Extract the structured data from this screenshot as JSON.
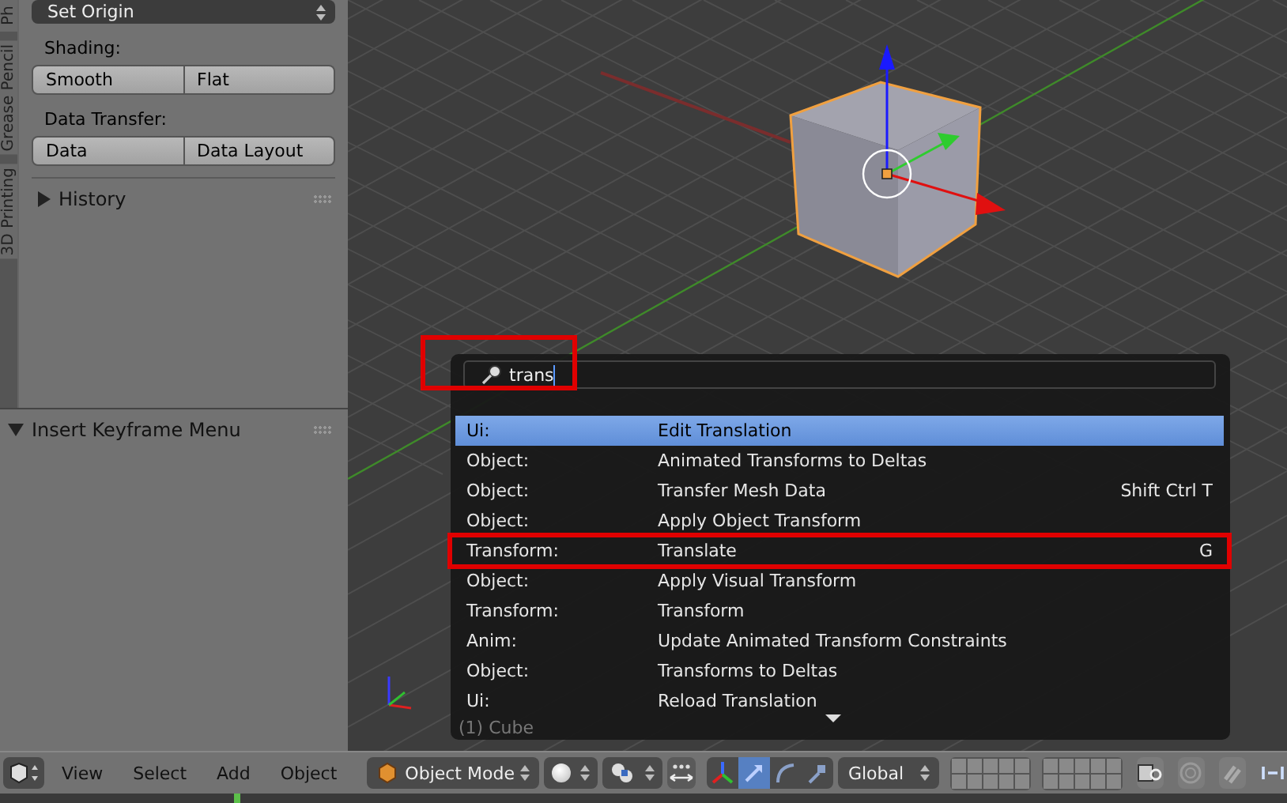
{
  "side_tabs": [
    "Ph",
    "Grease Pencil",
    "3D Printing"
  ],
  "tools_panel": {
    "origin_dropdown": "Set Origin",
    "groups": [
      {
        "label": "Shading:",
        "buttons": [
          "Smooth",
          "Flat"
        ]
      },
      {
        "label": "Data Transfer:",
        "buttons": [
          "Data",
          "Data Layout"
        ]
      }
    ],
    "history": {
      "label": "History",
      "expanded": false
    }
  },
  "keyframe_panel": {
    "label": "Insert Keyframe Menu",
    "expanded": true
  },
  "viewport": {
    "object_label": "(1) Cube"
  },
  "search_menu": {
    "query": "trans",
    "highlighted": true,
    "rows": [
      {
        "category": "Ui:",
        "name": "Edit Translation",
        "shortcut": "",
        "selected": true,
        "highlighted": false
      },
      {
        "category": "Object:",
        "name": "Animated Transforms to Deltas",
        "shortcut": "",
        "selected": false,
        "highlighted": false
      },
      {
        "category": "Object:",
        "name": "Transfer Mesh Data",
        "shortcut": "Shift Ctrl T",
        "selected": false,
        "highlighted": false
      },
      {
        "category": "Object:",
        "name": "Apply Object Transform",
        "shortcut": "",
        "selected": false,
        "highlighted": false
      },
      {
        "category": "Transform:",
        "name": "Translate",
        "shortcut": "G",
        "selected": false,
        "highlighted": true
      },
      {
        "category": "Object:",
        "name": "Apply Visual Transform",
        "shortcut": "",
        "selected": false,
        "highlighted": false
      },
      {
        "category": "Transform:",
        "name": "Transform",
        "shortcut": "",
        "selected": false,
        "highlighted": false
      },
      {
        "category": "Anim:",
        "name": "Update Animated Transform Constraints",
        "shortcut": "",
        "selected": false,
        "highlighted": false
      },
      {
        "category": "Object:",
        "name": "Transforms to Deltas",
        "shortcut": "",
        "selected": false,
        "highlighted": false
      },
      {
        "category": "Ui:",
        "name": "Reload Translation",
        "shortcut": "",
        "selected": false,
        "highlighted": false
      }
    ]
  },
  "header": {
    "menus": [
      "View",
      "Select",
      "Add",
      "Object"
    ],
    "mode": "Object Mode",
    "orientation": "Global",
    "manipulators": [
      {
        "kind": "axes",
        "selected": false
      },
      {
        "kind": "translate",
        "selected": true
      },
      {
        "kind": "rotate",
        "selected": false
      },
      {
        "kind": "scale",
        "selected": false
      }
    ]
  }
}
